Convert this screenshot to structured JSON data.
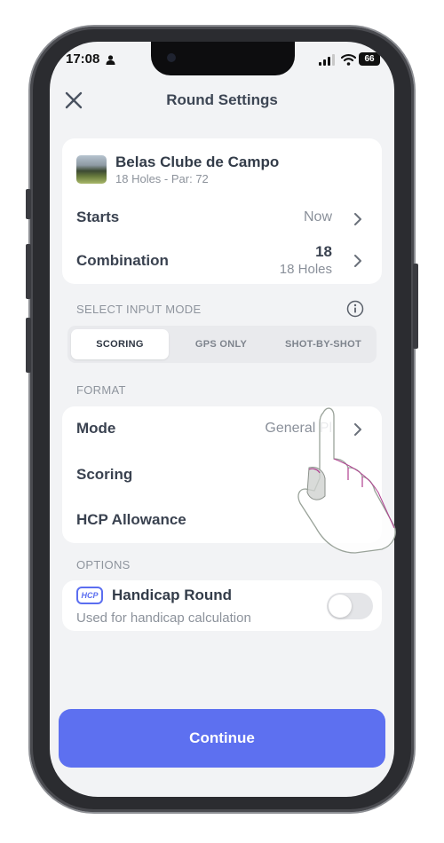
{
  "status_bar": {
    "time": "17:08",
    "battery": "66"
  },
  "header": {
    "title": "Round Settings"
  },
  "course": {
    "name": "Belas Clube de Campo",
    "details": "18 Holes - Par: 72"
  },
  "starts": {
    "label": "Starts",
    "value": "Now"
  },
  "combination": {
    "label": "Combination",
    "value": "18",
    "sub": "18 Holes"
  },
  "input_mode": {
    "section_label": "SELECT INPUT MODE",
    "options": [
      "SCORING",
      "GPS ONLY",
      "SHOT-BY-SHOT"
    ],
    "selected": "SCORING"
  },
  "format": {
    "section_label": "FORMAT",
    "mode_label": "Mode",
    "mode_value": "General Pl",
    "scoring_label": "Scoring",
    "hcp_label": "HCP Allowance"
  },
  "options": {
    "section_label": "OPTIONS",
    "badge": "HCP",
    "title": "Handicap Round",
    "subtitle": "Used for handicap calculation",
    "toggle_on": false
  },
  "continue_label": "Continue",
  "colors": {
    "accent": "#5d70f0",
    "background": "#f2f3f5"
  }
}
